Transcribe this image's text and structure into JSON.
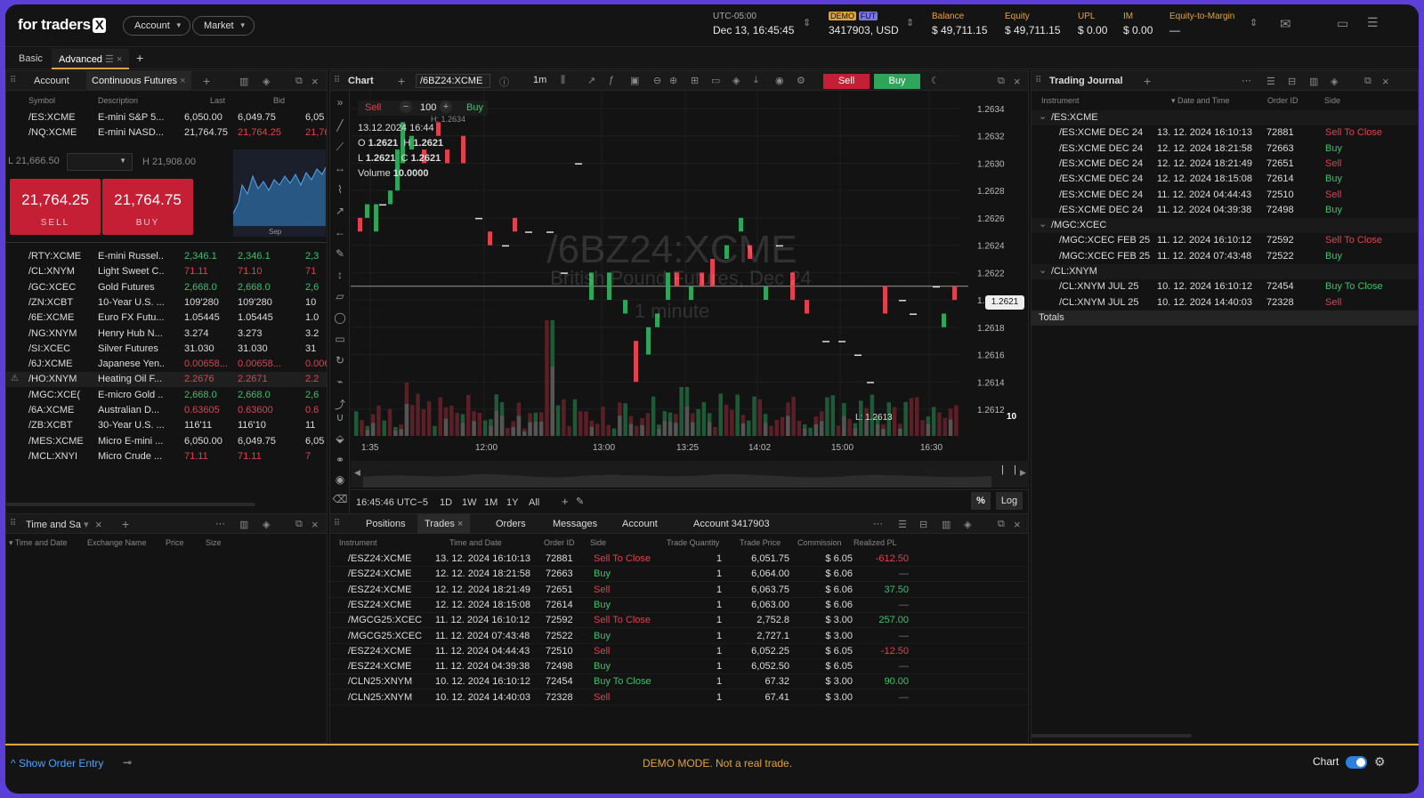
{
  "app": {
    "logo": "for traders",
    "logo_x": "X"
  },
  "top": {
    "account": "Account",
    "market": "Market",
    "tz": "UTC-05:00",
    "datetime": "Dec 13, 16:45:45",
    "demo": "DEMO",
    "fut": "FUT",
    "acct": "3417903, USD",
    "balance_l": "Balance",
    "balance": "$ 49,711.15",
    "equity_l": "Equity",
    "equity": "$ 49,711.15",
    "upl_l": "UPL",
    "upl": "$ 0.00",
    "im_l": "IM",
    "im": "$ 0.00",
    "etm_l": "Equity-to-Margin",
    "etm": "—"
  },
  "tabs": {
    "basic": "Basic",
    "advanced": "Advanced"
  },
  "watch": {
    "tab_account": "Account",
    "tab_cf": "Continuous Futures",
    "col_symbol": "Symbol",
    "col_desc": "Description",
    "col_last": "Last",
    "col_bid": "Bid",
    "top_rows": [
      {
        "s": "/ES:XCME",
        "d": "E-mini S&P 5...",
        "l": "6,050.00",
        "b": "6,049.75",
        "x": "6,05",
        "c": ""
      },
      {
        "s": "/NQ:XCME",
        "d": "E-mini NASD...",
        "l": "21,764.75",
        "b": "21,764.25",
        "x": "21,76",
        "c": "red"
      }
    ],
    "low": "L 21,666.50",
    "high": "H 21,908.00",
    "sell_price": "21,764.25",
    "sell": "SELL",
    "buy_price": "21,764.75",
    "buy": "BUY",
    "mini_label": "Sep",
    "rows": [
      {
        "s": "/RTY:XCME",
        "d": "E-mini Russel...",
        "l": "2,346.1",
        "b": "2,346.1",
        "x": "2,3",
        "c": "green"
      },
      {
        "s": "/CL:XNYM",
        "d": "Light Sweet C...",
        "l": "71.11",
        "b": "71.10",
        "x": "71",
        "c": "red"
      },
      {
        "s": "/GC:XCEC",
        "d": "Gold Futures",
        "l": "2,668.0",
        "b": "2,668.0",
        "x": "2,6",
        "c": "green"
      },
      {
        "s": "/ZN:XCBT",
        "d": "10-Year U.S. ...",
        "l": "109'280",
        "b": "109'280",
        "x": "10",
        "c": ""
      },
      {
        "s": "/6E:XCME",
        "d": "Euro FX Futu...",
        "l": "1.05445",
        "b": "1.05445",
        "x": "1.0",
        "c": ""
      },
      {
        "s": "/NG:XNYM",
        "d": "Henry Hub N...",
        "l": "3.274",
        "b": "3.273",
        "x": "3.2",
        "c": ""
      },
      {
        "s": "/SI:XCEC",
        "d": "Silver Futures",
        "l": "31.030",
        "b": "31.030",
        "x": "31",
        "c": ""
      },
      {
        "s": "/6J:XCME",
        "d": "Japanese Yen...",
        "l": "0.00658...",
        "b": "0.00658...",
        "x": "0.006",
        "c": "red"
      },
      {
        "s": "/HO:XNYM",
        "d": "Heating Oil F...",
        "l": "2.2676",
        "b": "2.2671",
        "x": "2.2",
        "c": "red"
      },
      {
        "s": "/MGC:XCE(",
        "d": "E-micro Gold ...",
        "l": "2,668.0",
        "b": "2,668.0",
        "x": "2,6",
        "c": "green"
      },
      {
        "s": "/6A:XCME",
        "d": "Australian D...",
        "l": "0.63605",
        "b": "0.63600",
        "x": "0.6",
        "c": "red"
      },
      {
        "s": "/ZB:XCBT",
        "d": "30-Year U.S. ...",
        "l": "116'11",
        "b": "116'10",
        "x": "11",
        "c": ""
      },
      {
        "s": "/MES:XCME",
        "d": "Micro E-mini ...",
        "l": "6,050.00",
        "b": "6,049.75",
        "x": "6,05",
        "c": ""
      },
      {
        "s": "/MCL:XNYI",
        "d": "Micro Crude ...",
        "l": "71.11",
        "b": "71.11",
        "x": "7",
        "c": "red"
      }
    ]
  },
  "ts": {
    "title": "Time and Sa",
    "col_td": "Time and Date",
    "col_ex": "Exchange Name",
    "col_price": "Price",
    "col_size": "Size"
  },
  "chart": {
    "title": "Chart",
    "symbol": "/6BZ24:XCME",
    "interval": "1m",
    "sell": "Sell",
    "buy": "Buy",
    "qty": "100",
    "date": "13.12.2024 16:44",
    "o": "1.2621",
    "h": "1.2621",
    "l": "1.2621",
    "c": "1.2621",
    "volume": "10.0000",
    "wm_sym": "/6BZ24:XCME",
    "wm_desc": "British Pound Futures, Dec 24",
    "wm_int": "1 minute",
    "hi_label": "H: 1.2634",
    "lo_label": "L: 1.2613",
    "vol_label": "10",
    "last": "1.2621",
    "prices": [
      "1.2634",
      "1.2632",
      "1.2630",
      "1.2628",
      "1.2626",
      "1.2624",
      "1.2622",
      "1.2620",
      "1.2618",
      "1.2616",
      "1.2614",
      "1.2612"
    ],
    "times": [
      "1:35",
      "12:00",
      "13:00",
      "13:25",
      "14:02",
      "15:00",
      "16:30"
    ],
    "clock": "16:45:46 UTC−5",
    "ranges": [
      "1D",
      "1W",
      "1M",
      "1Y",
      "All"
    ],
    "pct": "%",
    "log": "Log"
  },
  "journal": {
    "title": "Trading Journal",
    "col_inst": "Instrument",
    "col_dt": "Date and Time",
    "col_id": "Order ID",
    "col_side": "Side",
    "groups": [
      {
        "name": "/ES:XCME",
        "rows": [
          [
            "/ES:XCME DEC 24",
            "13. 12. 2024 16:10:13",
            "72881",
            "Sell To Close"
          ],
          [
            "/ES:XCME DEC 24",
            "12. 12. 2024 18:21:58",
            "72663",
            "Buy"
          ],
          [
            "/ES:XCME DEC 24",
            "12. 12. 2024 18:21:49",
            "72651",
            "Sell"
          ],
          [
            "/ES:XCME DEC 24",
            "12. 12. 2024 18:15:08",
            "72614",
            "Buy"
          ],
          [
            "/ES:XCME DEC 24",
            "11. 12. 2024 04:44:43",
            "72510",
            "Sell"
          ],
          [
            "/ES:XCME DEC 24",
            "11. 12. 2024 04:39:38",
            "72498",
            "Buy"
          ]
        ]
      },
      {
        "name": "/MGC:XCEC",
        "rows": [
          [
            "/MGC:XCEC FEB 25",
            "11. 12. 2024 16:10:12",
            "72592",
            "Sell To Close"
          ],
          [
            "/MGC:XCEC FEB 25",
            "11. 12. 2024 07:43:48",
            "72522",
            "Buy"
          ]
        ]
      },
      {
        "name": "/CL:XNYM",
        "rows": [
          [
            "/CL:XNYM JUL 25",
            "10. 12. 2024 16:10:12",
            "72454",
            "Buy To Close"
          ],
          [
            "/CL:XNYM JUL 25",
            "10. 12. 2024 14:40:03",
            "72328",
            "Sell"
          ]
        ]
      }
    ],
    "totals": "Totals"
  },
  "trades": {
    "tabs": [
      "Positions",
      "Trades",
      "Orders",
      "Messages",
      "Account"
    ],
    "acct": "Account  3417903",
    "cols": [
      "Instrument",
      "Time and Date",
      "Order ID",
      "Side",
      "Trade Quantity",
      "Trade Price",
      "Commission",
      "Realized PL"
    ],
    "rows": [
      [
        "/ESZ24:XCME",
        "13. 12. 2024 16:10:13",
        "72881",
        "Sell To Close",
        "1",
        "6,051.75",
        "$ 6.05",
        "-612.50"
      ],
      [
        "/ESZ24:XCME",
        "12. 12. 2024 18:21:58",
        "72663",
        "Buy",
        "1",
        "6,064.00",
        "$ 6.06",
        "—"
      ],
      [
        "/ESZ24:XCME",
        "12. 12. 2024 18:21:49",
        "72651",
        "Sell",
        "1",
        "6,063.75",
        "$ 6.06",
        "37.50"
      ],
      [
        "/ESZ24:XCME",
        "12. 12. 2024 18:15:08",
        "72614",
        "Buy",
        "1",
        "6,063.00",
        "$ 6.06",
        "—"
      ],
      [
        "/MGCG25:XCEC",
        "11. 12. 2024 16:10:12",
        "72592",
        "Sell To Close",
        "1",
        "2,752.8",
        "$ 3.00",
        "257.00"
      ],
      [
        "/MGCG25:XCEC",
        "11. 12. 2024 07:43:48",
        "72522",
        "Buy",
        "1",
        "2,727.1",
        "$ 3.00",
        "—"
      ],
      [
        "/ESZ24:XCME",
        "11. 12. 2024 04:44:43",
        "72510",
        "Sell",
        "1",
        "6,052.25",
        "$ 6.05",
        "-12.50"
      ],
      [
        "/ESZ24:XCME",
        "11. 12. 2024 04:39:38",
        "72498",
        "Buy",
        "1",
        "6,052.50",
        "$ 6.05",
        "—"
      ],
      [
        "/CLN25:XNYM",
        "10. 12. 2024 16:10:12",
        "72454",
        "Buy To Close",
        "1",
        "67.32",
        "$ 3.00",
        "90.00"
      ],
      [
        "/CLN25:XNYM",
        "10. 12. 2024 14:40:03",
        "72328",
        "Sell",
        "1",
        "67.41",
        "$ 3.00",
        "—"
      ]
    ]
  },
  "bottom": {
    "show": "Show Order Entry",
    "demo": "DEMO MODE. Not a real trade.",
    "chart": "Chart"
  }
}
